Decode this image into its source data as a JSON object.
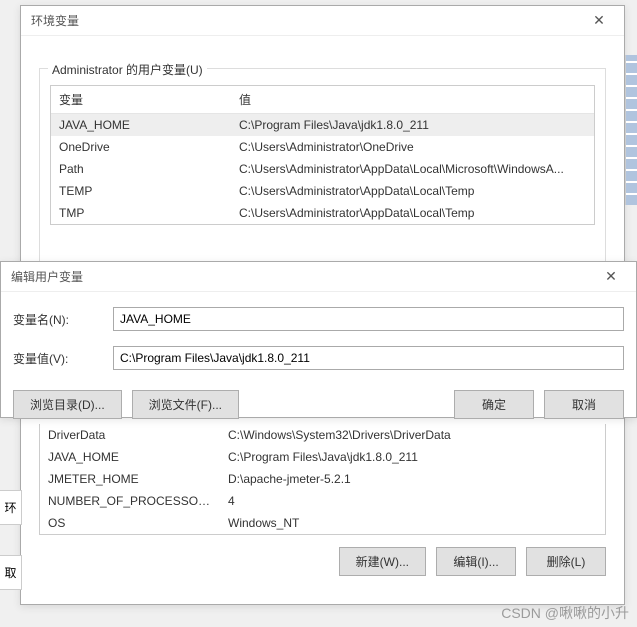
{
  "envDialog": {
    "title": "环境变量",
    "userVarsLabel": "Administrator 的用户变量(U)",
    "columns": {
      "var": "变量",
      "val": "值"
    },
    "userVars": [
      {
        "name": "JAVA_HOME",
        "value": "C:\\Program Files\\Java\\jdk1.8.0_211"
      },
      {
        "name": "OneDrive",
        "value": "C:\\Users\\Administrator\\OneDrive"
      },
      {
        "name": "Path",
        "value": "C:\\Users\\Administrator\\AppData\\Local\\Microsoft\\WindowsA..."
      },
      {
        "name": "TEMP",
        "value": "C:\\Users\\Administrator\\AppData\\Local\\Temp"
      },
      {
        "name": "TMP",
        "value": "C:\\Users\\Administrator\\AppData\\Local\\Temp"
      }
    ],
    "sysVars": [
      {
        "name": "DriverData",
        "value": "C:\\Windows\\System32\\Drivers\\DriverData"
      },
      {
        "name": "JAVA_HOME",
        "value": "C:\\Program Files\\Java\\jdk1.8.0_211"
      },
      {
        "name": "JMETER_HOME",
        "value": "D:\\apache-jmeter-5.2.1"
      },
      {
        "name": "NUMBER_OF_PROCESSORS",
        "value": "4"
      },
      {
        "name": "OS",
        "value": "Windows_NT"
      }
    ],
    "buttons": {
      "new": "新建(W)...",
      "edit": "编辑(I)...",
      "delete": "删除(L)"
    }
  },
  "editDialog": {
    "title": "编辑用户变量",
    "nameLabel": "变量名(N):",
    "nameValue": "JAVA_HOME",
    "valueLabel": "变量值(V):",
    "valueValue": "C:\\Program Files\\Java\\jdk1.8.0_211",
    "buttons": {
      "browseDir": "浏览目录(D)...",
      "browseFile": "浏览文件(F)...",
      "ok": "确定",
      "cancel": "取消"
    }
  },
  "fragments": {
    "left1": "环",
    "left2": "取"
  },
  "watermark": "CSDN @啾啾的小升"
}
